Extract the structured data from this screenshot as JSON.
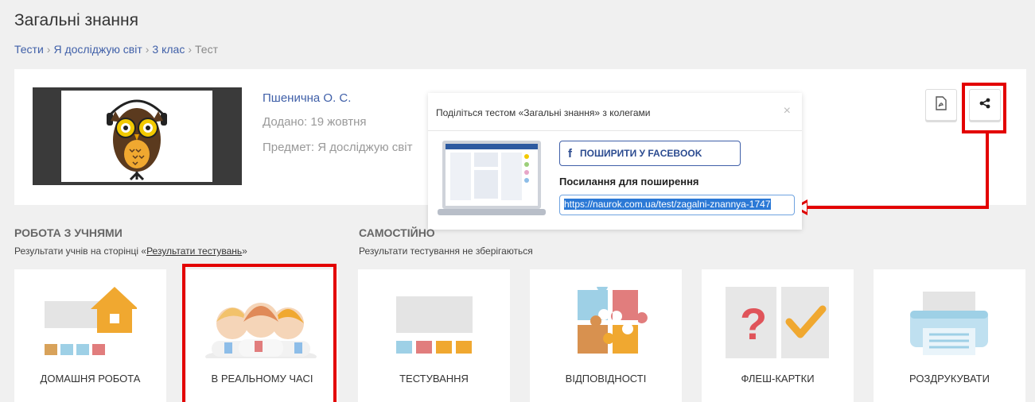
{
  "page": {
    "title": "Загальні знання"
  },
  "breadcrumb": {
    "items": [
      "Тести",
      "Я досліджую світ",
      "3 клас"
    ],
    "current": "Тест"
  },
  "test_info": {
    "author": "Пшенична О. С.",
    "added": "Додано: 19 жовтня",
    "subject": "Предмет: Я досліджую світ"
  },
  "share_popup": {
    "title": "Поділіться тестом «Загальні знання» з колегами",
    "close": "×",
    "facebook_label": "ПОШИРИТИ У FACEBOOK",
    "link_label": "Посилання для поширення",
    "link_value": "https://naurok.com.ua/test/zagalni-znannya-1747"
  },
  "sections": {
    "with_students": {
      "title": "РОБОТА З УЧНЯМИ",
      "sub_prefix": "Результати учнів на сторінці «",
      "sub_link": "Результати тестувань",
      "sub_suffix": "»"
    },
    "self": {
      "title": "САМОСТІЙНО",
      "sub": "Результати тестування не зберігаються"
    }
  },
  "tiles": [
    "ДОМАШНЯ РОБОТА",
    "В РЕАЛЬНОМУ ЧАСІ",
    "ТЕСТУВАННЯ",
    "ВІДПОВІДНОСТІ",
    "ФЛЕШ-КАРТКИ",
    "РОЗДРУКУВАТИ"
  ],
  "colors": {
    "highlight": "#e30000",
    "link": "#3f5fa8",
    "accent_orange": "#f0a830"
  },
  "icons": {
    "pdf": "pdf-icon",
    "share": "share-icon",
    "facebook": "facebook-icon"
  }
}
